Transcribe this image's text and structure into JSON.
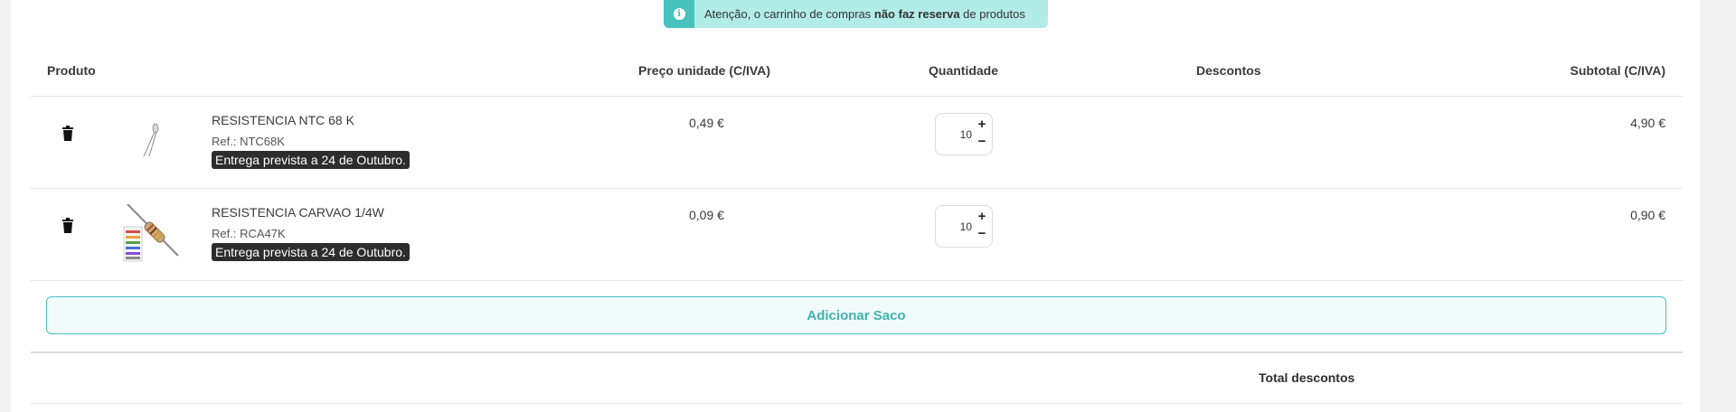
{
  "alert": {
    "text_before": "Atenção, o carrinho de compras ",
    "text_bold": "não faz reserva",
    "text_after": " de produtos",
    "icon": "info-icon"
  },
  "table": {
    "headers": {
      "product": "Produto",
      "unit_price": "Preço unidade (C/IVA)",
      "quantity": "Quantidade",
      "discounts": "Descontos",
      "subtotal": "Subtotal (C/IVA)"
    },
    "rows": [
      {
        "name": "RESISTENCIA NTC 68 K",
        "ref": "Ref.: NTC68K",
        "delivery": "Entrega prevista a 24 de Outubro.",
        "unit_price": "0,49 €",
        "quantity": "10",
        "subtotal": "4,90 €"
      },
      {
        "name": "RESISTENCIA CARVAO 1/4W",
        "ref": "Ref.: RCA47K",
        "delivery": "Entrega prevista a 24 de Outubro.",
        "unit_price": "0,09 €",
        "quantity": "10",
        "subtotal": "0,90 €"
      }
    ]
  },
  "add_bag_label": "Adicionar Saco",
  "totals": {
    "discounts_label": "Total descontos"
  },
  "colors": {
    "accent": "#47c2bd",
    "alert_bg": "#b2ece6"
  }
}
